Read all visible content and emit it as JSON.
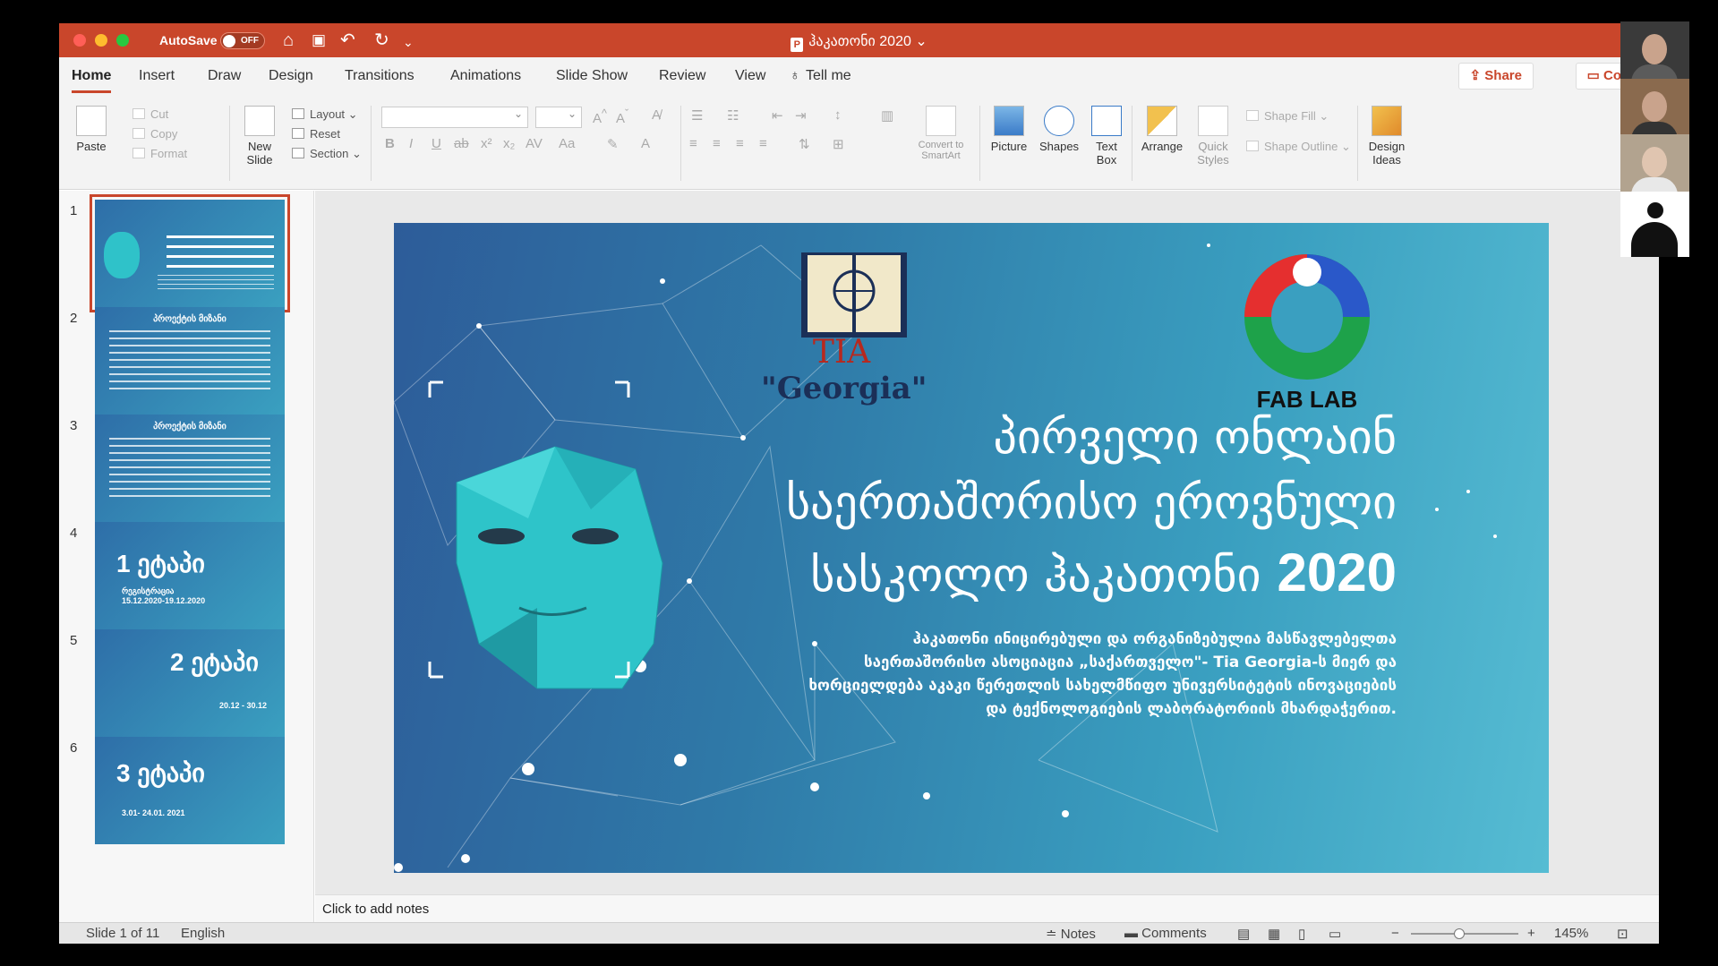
{
  "titlebar": {
    "autosave_label": "AutoSave",
    "autosave_state": "OFF",
    "doc_title": "ჰაკათონი 2020",
    "doc_title_suffix": " ⌄"
  },
  "tabs": [
    {
      "label": "Home",
      "active": true
    },
    {
      "label": "Insert"
    },
    {
      "label": "Draw"
    },
    {
      "label": "Design"
    },
    {
      "label": "Transitions"
    },
    {
      "label": "Animations"
    },
    {
      "label": "Slide Show"
    },
    {
      "label": "Review"
    },
    {
      "label": "View"
    },
    {
      "label": "Tell me"
    }
  ],
  "share_label": "Share",
  "comments_label": "Comme",
  "ribbon": {
    "paste": "Paste",
    "cut": "Cut",
    "copy": "Copy",
    "format": "Format",
    "new_slide": "New\nSlide",
    "layout": "Layout",
    "reset": "Reset",
    "section": "Section",
    "convert_smartart": "Convert to\nSmartArt",
    "picture": "Picture",
    "shapes": "Shapes",
    "text_box": "Text\nBox",
    "arrange": "Arrange",
    "quick_styles": "Quick\nStyles",
    "shape_fill": "Shape Fill",
    "shape_outline": "Shape Outline",
    "design_ideas": "Design\nIdeas"
  },
  "thumbnails": [
    {
      "num": "1",
      "selected": true
    },
    {
      "num": "2",
      "title": "პროექტის მიზანი"
    },
    {
      "num": "3",
      "title": "პროექტის მიზანი"
    },
    {
      "num": "4",
      "stage": "1 ეტაპი",
      "sub": "რეგისტრაცია\n15.12.2020-19.12.2020"
    },
    {
      "num": "5",
      "stage": "2 ეტაპი",
      "sub": "20.12 - 30.12"
    },
    {
      "num": "6",
      "stage": "3 ეტაპი",
      "sub": "3.01- 24.01. 2021"
    }
  ],
  "slide": {
    "tia": "TIA",
    "tia_georgia": "\"Georgia\"",
    "fablab": "FAB LAB",
    "title_line1": "პირველი ონლაინ",
    "title_line2": "საერთაშორისო ეროვნული",
    "title_line3": "სასკოლო ჰაკათონი",
    "title_year": "2020",
    "body": "ჰაკათონი ინიცირებული და ორგანიზებულია მასწავლებელთა საერთაშორისო ასოციაცია „საქართველო\"- Tia Georgia-ს მიერ და ხორციელდება აკაკი წერეთლის სახელმწიფო უნივერსიტეტის ინოვაციების და ტექნოლოგიების ლაბორატორიის მხარდაჭერით."
  },
  "notes_placeholder": "Click to add notes",
  "status": {
    "slide_indicator": "Slide 1 of 11",
    "language": "English",
    "notes": "Notes",
    "comments": "Comments",
    "zoom": "145%",
    "zoom_fraction": 0.45
  },
  "colors": {
    "accent": "#c9462b",
    "slide_bg_start": "#2d5c99",
    "slide_bg_end": "#56bcd3"
  }
}
